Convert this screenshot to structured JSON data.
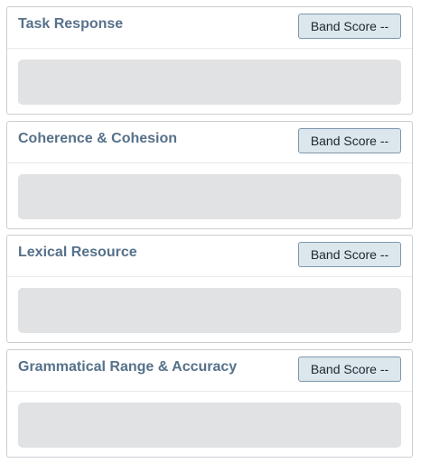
{
  "criteria": [
    {
      "title": "Task Response",
      "band_score_label": "Band Score --",
      "response_text": ""
    },
    {
      "title": "Coherence & Cohesion",
      "band_score_label": "Band Score --",
      "response_text": ""
    },
    {
      "title": "Lexical Resource",
      "band_score_label": "Band Score --",
      "response_text": ""
    },
    {
      "title": "Grammatical Range & Accuracy",
      "band_score_label": "Band Score --",
      "response_text": ""
    }
  ],
  "colors": {
    "title": "#56718a",
    "badge_background": "#dbe7ec",
    "badge_border": "#7d97ad",
    "response_background": "#e1e2e4",
    "panel_border": "#c9ced3"
  }
}
